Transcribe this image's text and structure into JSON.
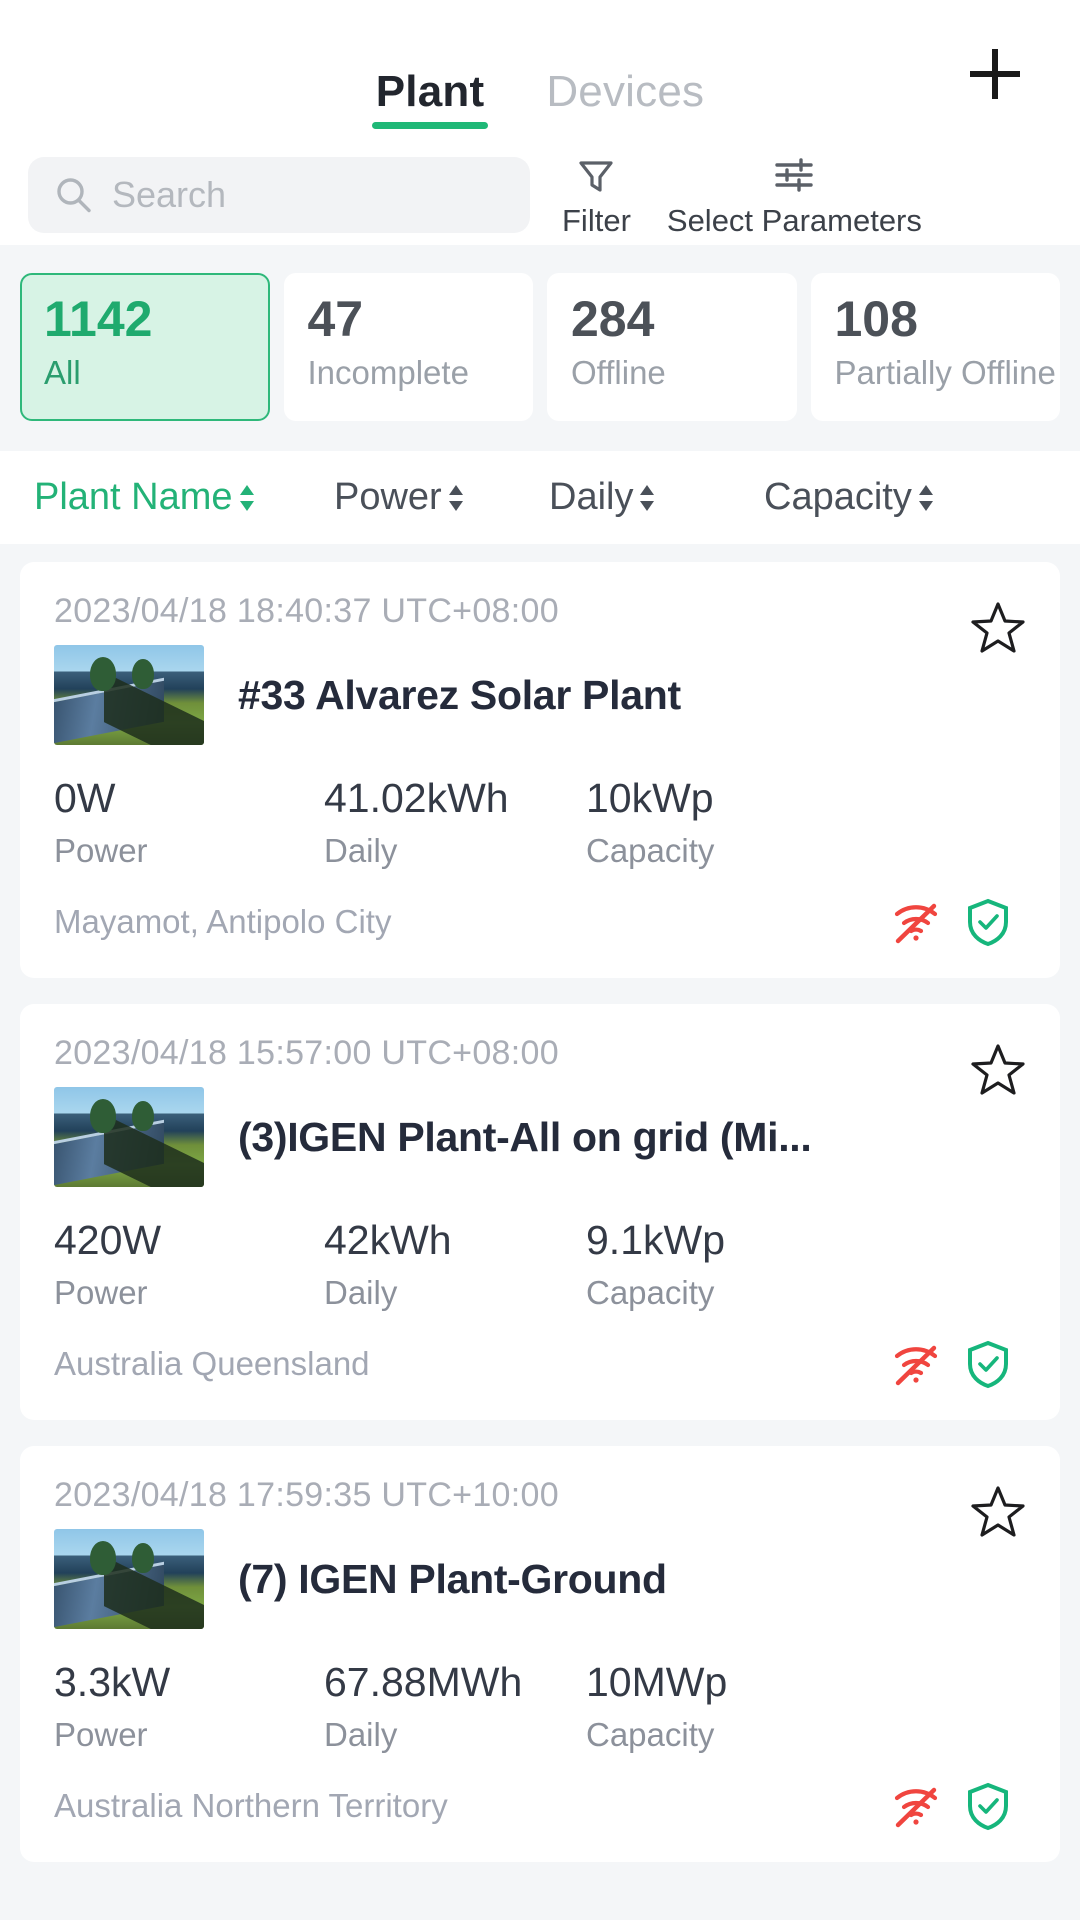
{
  "header": {
    "tabs": [
      {
        "label": "Plant",
        "active": true
      },
      {
        "label": "Devices",
        "active": false
      }
    ],
    "add_button": "add-plant",
    "accent_color": "#1fb877"
  },
  "search": {
    "placeholder": "Search",
    "icon": "search-icon",
    "tools": [
      {
        "label": "Filter",
        "icon": "filter-funnel-icon"
      },
      {
        "label": "Select Parameters",
        "icon": "sliders-icon"
      }
    ]
  },
  "status_chips": [
    {
      "count": "1142",
      "label": "All",
      "selected": true
    },
    {
      "count": "47",
      "label": "Incomplete",
      "selected": false
    },
    {
      "count": "284",
      "label": "Offline",
      "selected": false
    },
    {
      "count": "108",
      "label": "Partially Offline",
      "selected": false
    }
  ],
  "sort_header": [
    {
      "label": "Plant Name",
      "active": true
    },
    {
      "label": "Power",
      "active": false
    },
    {
      "label": "Daily",
      "active": false
    },
    {
      "label": "Capacity",
      "active": false
    }
  ],
  "plants": [
    {
      "timestamp": "2023/04/18 18:40:37 UTC+08:00",
      "name": "#33 Alvarez Solar Plant",
      "power_value": "0W",
      "power_label": "Power",
      "daily_value": "41.02kWh",
      "daily_label": "Daily",
      "capacity_value": "10kWp",
      "capacity_label": "Capacity",
      "location": "Mayamot, Antipolo City",
      "favorited": false,
      "status_icons": [
        "wifi-off-icon",
        "shield-check-icon"
      ]
    },
    {
      "timestamp": "2023/04/18 15:57:00 UTC+08:00",
      "name": "(3)IGEN Plant-All on grid (Mi...",
      "power_value": "420W",
      "power_label": "Power",
      "daily_value": "42kWh",
      "daily_label": "Daily",
      "capacity_value": "9.1kWp",
      "capacity_label": "Capacity",
      "location": "Australia Queensland",
      "favorited": false,
      "status_icons": [
        "wifi-off-icon",
        "shield-check-icon"
      ]
    },
    {
      "timestamp": "2023/04/18 17:59:35 UTC+10:00",
      "name": "(7) IGEN Plant-Ground",
      "power_value": "3.3kW",
      "power_label": "Power",
      "daily_value": "67.88MWh",
      "daily_label": "Daily",
      "capacity_value": "10MWp",
      "capacity_label": "Capacity",
      "location": "Australia Northern Territory",
      "favorited": false,
      "status_icons": [
        "wifi-off-icon",
        "shield-check-icon"
      ]
    }
  ],
  "colors": {
    "accent_green": "#1fb877",
    "chip_selected_bg": "#d7f3e5",
    "offline_red": "#f0453f",
    "shield_green": "#16b67c",
    "page_bg": "#f4f6f8"
  }
}
